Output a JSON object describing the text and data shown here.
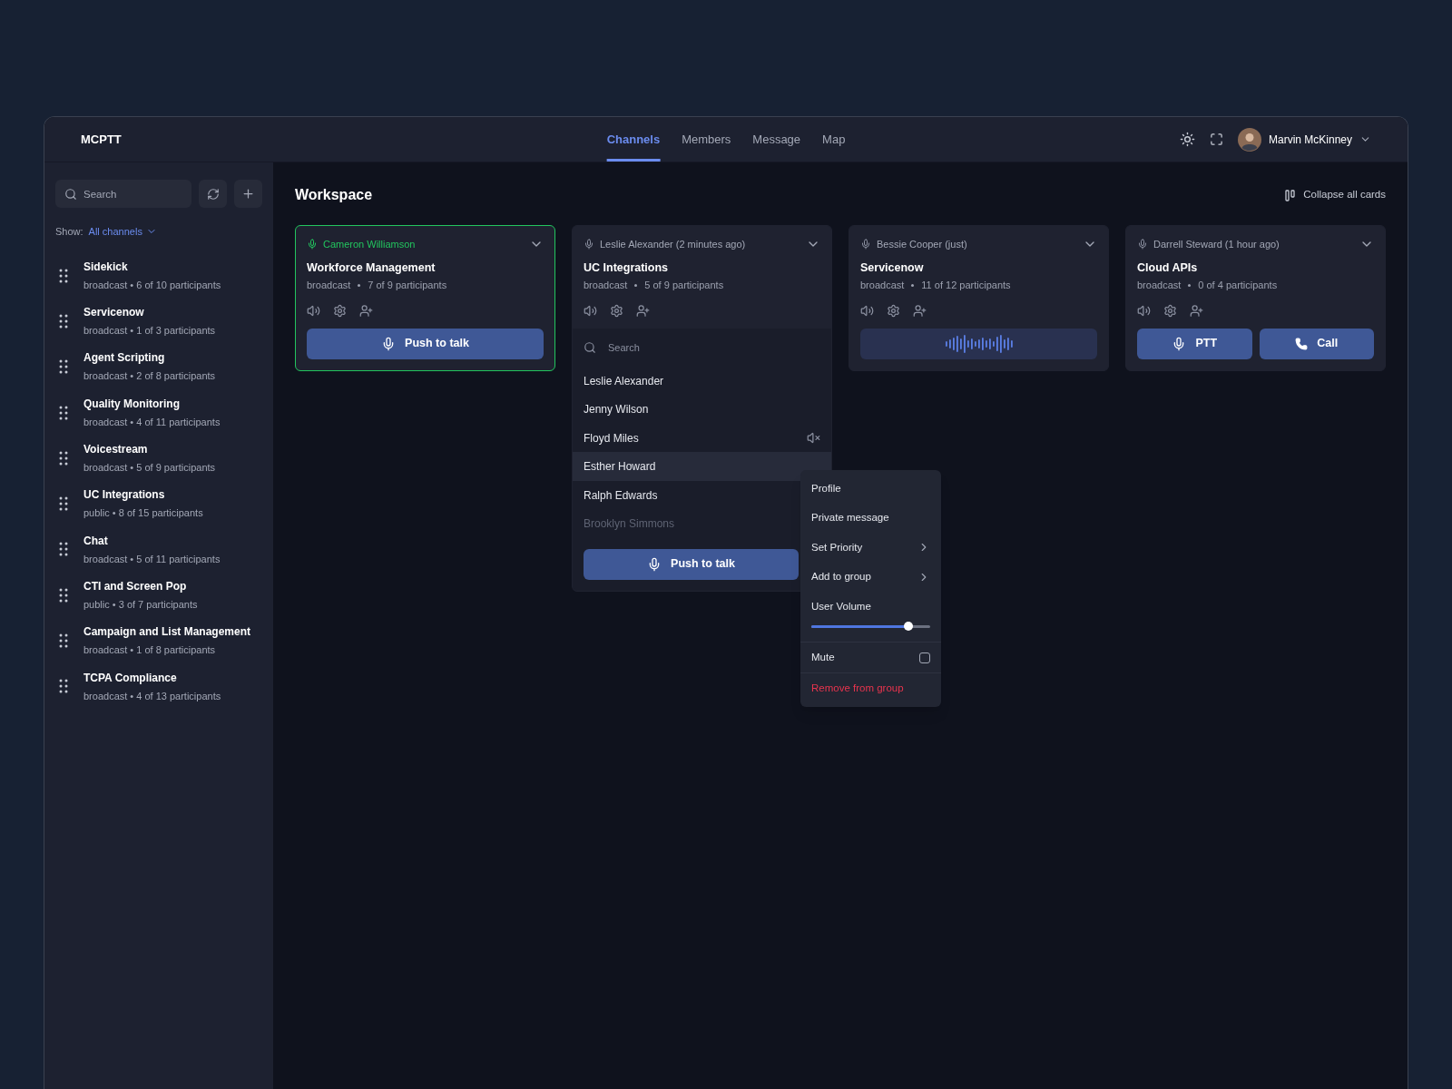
{
  "app_title": "MCPTT",
  "nav_tabs": [
    {
      "label": "Channels",
      "selected": true
    },
    {
      "label": "Members",
      "selected": false
    },
    {
      "label": "Message",
      "selected": false
    },
    {
      "label": "Map",
      "selected": false
    }
  ],
  "user": {
    "name": "Marvin McKinney"
  },
  "sidebar": {
    "search_placeholder": "Search",
    "filter_label": "Show:",
    "filter_value": "All channels",
    "channels": [
      {
        "name": "Sidekick",
        "info": "broadcast • 6 of 10 participants"
      },
      {
        "name": "Servicenow",
        "info": "broadcast • 1 of 3 participants"
      },
      {
        "name": "Agent Scripting",
        "info": "broadcast • 2 of 8 participants"
      },
      {
        "name": "Quality Monitoring",
        "info": "broadcast • 4 of 11 participants"
      },
      {
        "name": "Voicestream",
        "info": "broadcast • 5 of 9 participants"
      },
      {
        "name": "UC Integrations",
        "info": "public • 8 of 15 participants"
      },
      {
        "name": "Chat",
        "info": "broadcast • 5 of 11 participants"
      },
      {
        "name": "CTI and Screen Pop",
        "info": "public • 3 of 7 participants"
      },
      {
        "name": "Campaign and List Management",
        "info": "broadcast • 1 of 8 participants"
      },
      {
        "name": "TCPA Compliance",
        "info": "broadcast • 4 of 13 participants"
      }
    ]
  },
  "workspace": {
    "title": "Workspace",
    "collapse_label": "Collapse all cards"
  },
  "cards": [
    {
      "speaker": "Cameron Williamson",
      "speaking": true,
      "title": "Workforce Management",
      "type": "broadcast",
      "participants": "7 of 9 participants",
      "expanded": false,
      "actions": [
        {
          "kind": "talk",
          "label": "Push to talk"
        }
      ]
    },
    {
      "speaker": "Leslie Alexander (2 minutes ago)",
      "speaking": false,
      "title": "UC Integrations",
      "type": "broadcast",
      "participants": "5 of 9 participants",
      "expanded": true,
      "member_search_placeholder": "Search",
      "members": [
        {
          "name": "Leslie Alexander",
          "muted": false,
          "selected": false,
          "offline": false
        },
        {
          "name": "Jenny Wilson",
          "muted": false,
          "selected": false,
          "offline": false
        },
        {
          "name": "Floyd Miles",
          "muted": true,
          "selected": false,
          "offline": false
        },
        {
          "name": "Esther Howard",
          "muted": false,
          "selected": true,
          "offline": false
        },
        {
          "name": "Ralph Edwards",
          "selected": false,
          "offline": false
        },
        {
          "name": "Brooklyn Simmons",
          "selected": false,
          "offline": true
        }
      ],
      "actions": [
        {
          "kind": "talk",
          "label": "Push to talk"
        }
      ]
    },
    {
      "speaker": "Bessie Cooper (just)",
      "speaking": false,
      "title": "Servicenow",
      "type": "broadcast",
      "participants": "11 of 12 participants",
      "expanded": false,
      "actions": [
        {
          "kind": "waveform"
        }
      ]
    },
    {
      "speaker": "Darrell Steward (1 hour ago)",
      "speaking": false,
      "title": "Cloud APIs",
      "type": "broadcast",
      "participants": "0 of 4 participants",
      "expanded": false,
      "actions": [
        {
          "kind": "talk",
          "label": "PTT"
        },
        {
          "kind": "call",
          "label": "Call"
        }
      ]
    }
  ],
  "context_menu": {
    "items": [
      {
        "kind": "action",
        "label": "Profile"
      },
      {
        "kind": "action",
        "label": "Private message"
      },
      {
        "kind": "submenu",
        "label": "Set Priority"
      },
      {
        "kind": "submenu",
        "label": "Add to group"
      },
      {
        "kind": "slider",
        "label": "User Volume",
        "level": 0.82
      },
      {
        "kind": "checkbox",
        "label": "Mute",
        "checked": false
      },
      {
        "kind": "danger",
        "label": "Remove from group"
      }
    ]
  }
}
